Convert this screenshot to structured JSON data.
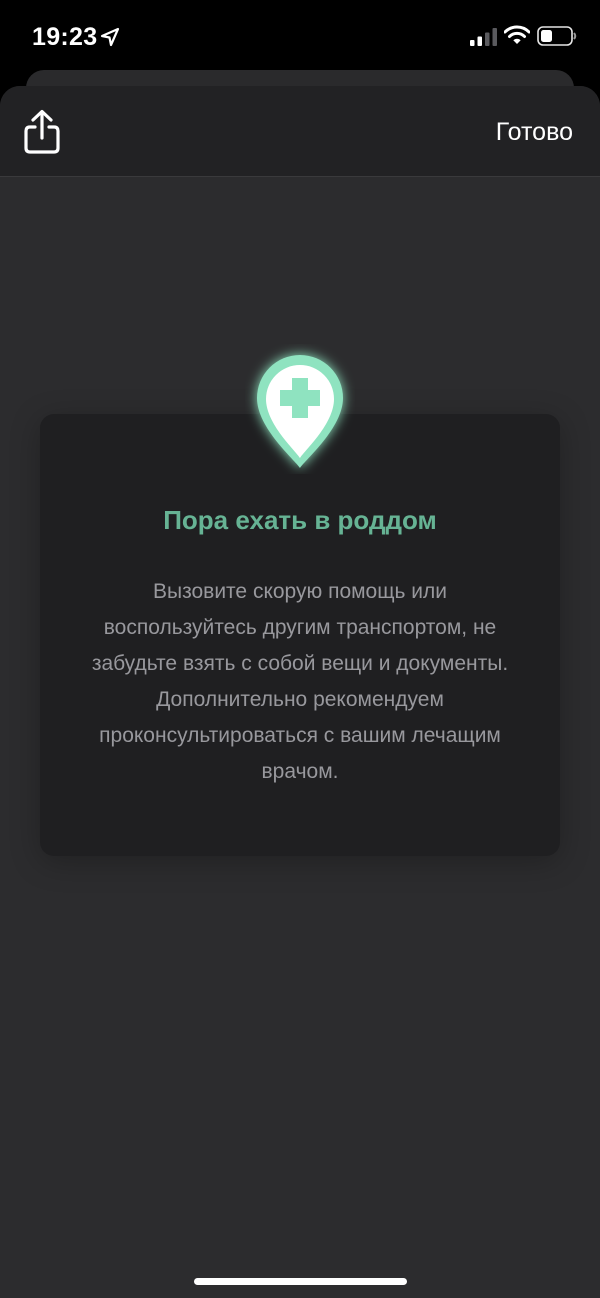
{
  "status_bar": {
    "time": "19:23",
    "icons": [
      "location-arrow-icon",
      "cellular-signal-icon",
      "wifi-icon",
      "battery-icon"
    ]
  },
  "header": {
    "share_icon": "share-icon",
    "done_label": "Готово"
  },
  "card": {
    "icon": "medical-location-pin-icon",
    "title": "Пора ехать в роддом",
    "body": "Вызовите скорую помощь или воспользуйтесь другим транспортом, не забудьте взять с собой вещи и документы. Дополнительно рекомендуем проконсультироваться с вашим лечащим врачом."
  },
  "colors": {
    "accent": "#66b394",
    "pin_fill": "#8fe3c0",
    "sheet_bg": "#2c2c2e",
    "card_bg": "#1f1f21",
    "header_bg": "#222224",
    "body_text": "#98989d"
  }
}
